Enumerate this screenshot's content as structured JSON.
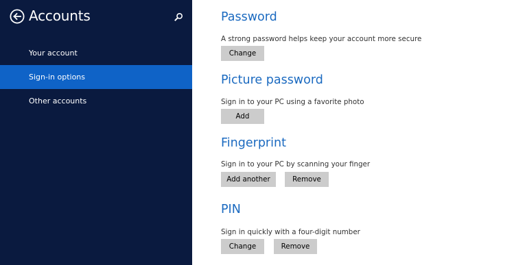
{
  "sidebar": {
    "title": "Accounts",
    "items": [
      {
        "label": "Your account"
      },
      {
        "label": "Sign-in options"
      },
      {
        "label": "Other accounts"
      }
    ]
  },
  "sections": {
    "password": {
      "title": "Password",
      "description": "A strong password helps keep your account more secure",
      "change_label": "Change"
    },
    "picture_password": {
      "title": "Picture password",
      "description": "Sign in to your PC using a favorite photo",
      "add_label": "Add"
    },
    "fingerprint": {
      "title": "Fingerprint",
      "description": "Sign in to your PC by scanning your finger",
      "add_another_label": "Add another",
      "remove_label": "Remove"
    },
    "pin": {
      "title": "PIN",
      "description": "Sign in quickly with a four-digit number",
      "change_label": "Change",
      "remove_label": "Remove"
    }
  },
  "colors": {
    "sidebar_bg": "#0a1a3f",
    "selected_bg": "#0f63c7",
    "accent": "#1b6ac0",
    "button_bg": "#cccccc"
  },
  "icons": {
    "back": "back-arrow-icon",
    "search": "search-icon"
  }
}
